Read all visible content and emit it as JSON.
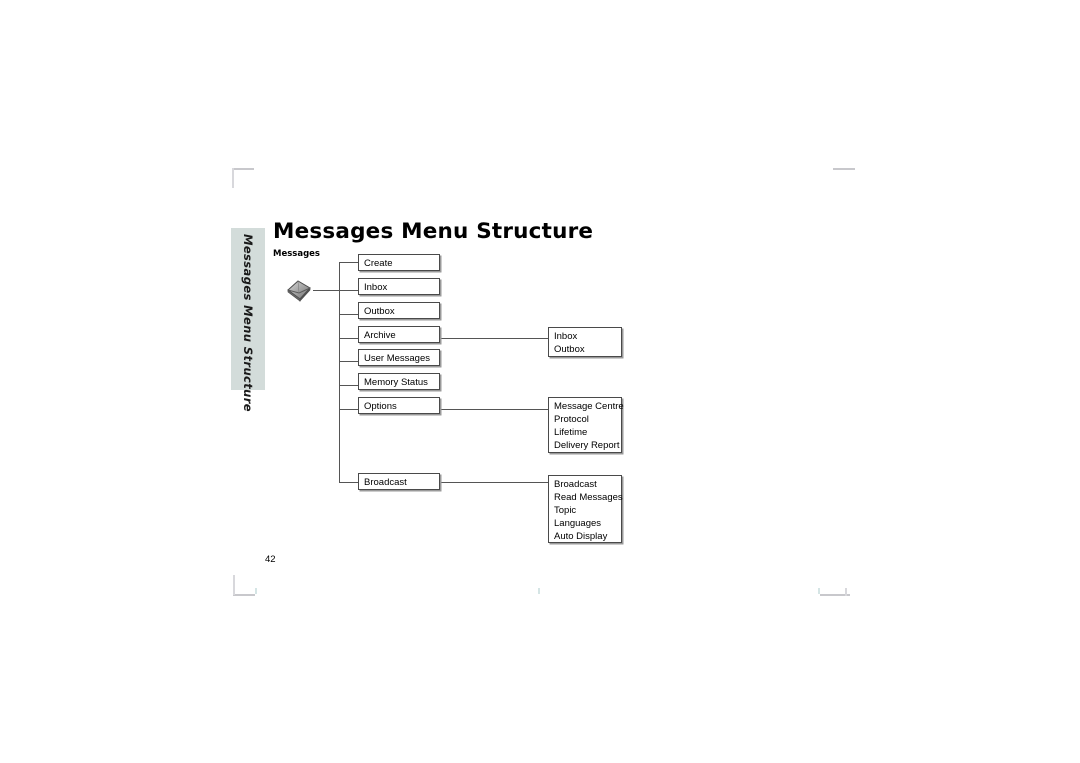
{
  "document": {
    "page_title": "Messages Menu Structure",
    "page_number": "42",
    "side_tab_label": "Messages Menu Structure",
    "root_label": "Messages",
    "root_icon": "envelope-icon"
  },
  "colors": {
    "side_tab_background": "#d3dcda",
    "node_border": "#4a4a4a",
    "node_shadow": "#9a9a9a",
    "connector_line": "#555555",
    "page_background": "#ffffff",
    "crop_mark": "#c8c8cc"
  },
  "chart_data": {
    "type": "diagram",
    "title": "Messages Menu Structure",
    "root": "Messages",
    "level1": [
      {
        "label": "Create",
        "children": []
      },
      {
        "label": "Inbox",
        "children": []
      },
      {
        "label": "Outbox",
        "children": []
      },
      {
        "label": "Archive",
        "children": [
          "Inbox",
          "Outbox"
        ]
      },
      {
        "label": "User Messages",
        "children": []
      },
      {
        "label": "Memory Status",
        "children": []
      },
      {
        "label": "Options",
        "children": [
          "Message Centre",
          "Protocol",
          "Lifetime",
          "Delivery Report"
        ]
      },
      {
        "label": "Broadcast",
        "children": [
          "Broadcast",
          "Read Messages",
          "Topic",
          "Languages",
          "Auto Display"
        ]
      }
    ]
  },
  "nodes": {
    "create": {
      "label": "Create"
    },
    "inbox": {
      "label": "Inbox"
    },
    "outbox": {
      "label": "Outbox"
    },
    "archive": {
      "label": "Archive"
    },
    "user_messages": {
      "label": "User Messages"
    },
    "memory_status": {
      "label": "Memory Status"
    },
    "options": {
      "label": "Options"
    },
    "broadcast": {
      "label": "Broadcast"
    }
  },
  "sub_archive": {
    "items": [
      "Inbox",
      "Outbox"
    ]
  },
  "sub_options": {
    "items": [
      "Message Centre",
      "Protocol",
      "Lifetime",
      "Delivery Report"
    ]
  },
  "sub_broadcast": {
    "items": [
      "Broadcast",
      "Read Messages",
      "Topic",
      "Languages",
      "Auto Display"
    ]
  }
}
